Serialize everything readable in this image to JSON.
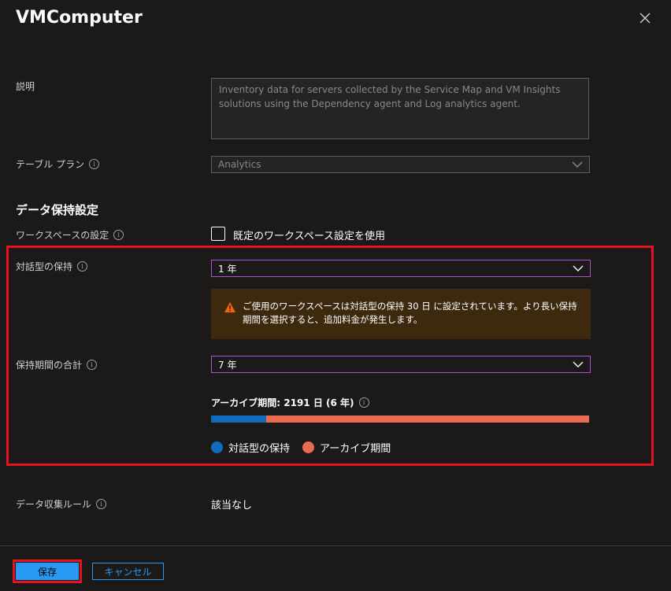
{
  "title": "VMComputer",
  "description": {
    "label": "説明",
    "value": "Inventory data for servers collected by the Service Map and VM Insights solutions using the Dependency agent and Log analytics agent."
  },
  "table_plan": {
    "label": "テーブル プラン",
    "value": "Analytics"
  },
  "retention": {
    "section_title": "データ保持設定",
    "workspace_label": "ワークスペースの設定",
    "workspace_checkbox_label": "既定のワークスペース設定を使用",
    "workspace_checkbox_checked": false,
    "interactive_label": "対話型の保持",
    "interactive_value": "1 年",
    "warning_text": "ご使用のワークスペースは対話型の保持 30 日 に設定されています。より長い保持期間を選択すると、追加料金が発生します。",
    "total_label": "保持期間の合計",
    "total_value": "7 年",
    "archive_label": "アーカイブ期間: 2191 日 (6 年)",
    "interactive_fraction": 0.146,
    "legend_interactive": "対話型の保持",
    "legend_archive": "アーカイブ期間",
    "color_interactive": "#0f6cbd",
    "color_archive": "#ea6b51"
  },
  "dcr": {
    "label": "データ収集ルール",
    "value": "該当なし"
  },
  "footer": {
    "save_label": "保存",
    "cancel_label": "キャンセル"
  }
}
